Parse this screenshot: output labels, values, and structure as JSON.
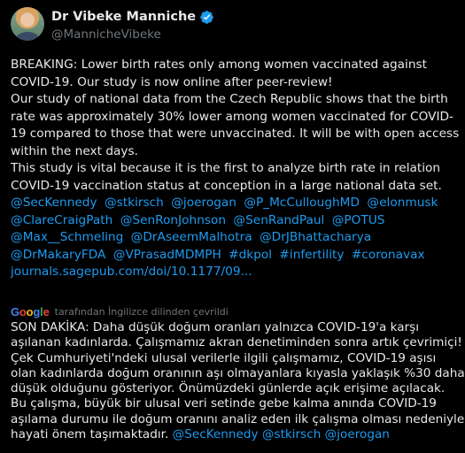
{
  "author": {
    "display_name": "Dr Vibeke Manniche",
    "handle": "@MannicheVibeke",
    "verified_color": "#1d9bf0"
  },
  "post": {
    "lines": [
      "BREAKING: Lower birth rates only among women vaccinated against",
      "COVID-19. Our study is now online after peer-review!",
      "Our study of national data from the Czech Republic shows that the birth",
      "rate was approximately 30% lower among women vaccinated for COVID-",
      "19 compared to those that were unvaccinated. It will be with open access",
      "within the next days.",
      "This study is vital because it is the first to analyze birth rate in relation",
      "COVID-19 vaccination status at conception in a large national data set."
    ],
    "mention_lines": [
      [
        "@SecKennedy",
        "@stkirsch",
        "@joerogan",
        "@P_McCulloughMD",
        "@elonmusk"
      ],
      [
        "@ClareCraigPath",
        "@SenRonJohnson",
        "@SenRandPaul",
        "@POTUS"
      ],
      [
        "@Max__Schmeling",
        "@DrAseemMalhotra",
        "@DrJBhattacharya"
      ],
      [
        "@DrMakaryFDA",
        "@VPrasadMDMPH",
        "#dkpol",
        "#infertility",
        "#coronavax"
      ]
    ],
    "link": "journals.sagepub.com/doi/10.1177/09..."
  },
  "translation": {
    "provider": "Google",
    "label": "tarafından İngilizce dilinden çevrildi",
    "lines": [
      "SON DAKİKA: Daha düşük doğum oranları yalnızca COVID-19'a karşı",
      "aşılanan kadınlarda. Çalışmamız akran denetiminden sonra artık çevrimiçi!",
      "Çek Cumhuriyeti'ndeki ulusal verilerle ilgili çalışmamız, COVID-19 aşısı",
      "olan kadınlarda doğum oranının aşı olmayanlara kıyasla yaklaşık %30 daha",
      "düşük olduğunu gösteriyor. Önümüzdeki günlerde açık erişime açılacak.",
      "Bu çalışma, büyük bir ulusal veri setinde gebe kalma anında COVID-19",
      "aşılama durumu ile doğum oranını analiz eden ilk çalışma olması nedeniyle"
    ],
    "last_line_text": "hayati önem taşımaktadır.",
    "last_line_mentions": [
      "@SecKennedy",
      "@stkirsch",
      "@joerogan"
    ]
  }
}
